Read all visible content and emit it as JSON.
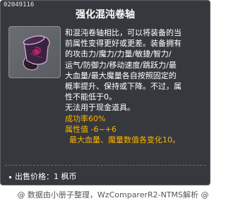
{
  "tooltip": {
    "item_id": "02049116",
    "title": "强化混沌卷轴",
    "icon": "scroll-icon",
    "description_lines": [
      "和混沌卷轴相比，可以将装备的当",
      "前属性变得更好或更差。装备拥有",
      "的攻击力/魔力/力量/敏捷/智力/",
      "运气/防御力/移动速度/跳跃力/最",
      "大血量/最大魔量各自按照固定的",
      "概率提升、保持或下降。不过，属",
      "性不能低于0。",
      "无法用于现金道具。"
    ],
    "success_rate": "成功率60%",
    "attribute_value": "属性值 -6~+6",
    "hp_mp_note": "最大血量、魔量数值各变化10。",
    "price_label": "出售价格：1 枫币",
    "colors": {
      "background": "#35393e",
      "accent": "#ffb400"
    }
  },
  "footer": {
    "credit": "@ 数据由小册子整理，WzComparerR2-NTMS解析 @"
  }
}
